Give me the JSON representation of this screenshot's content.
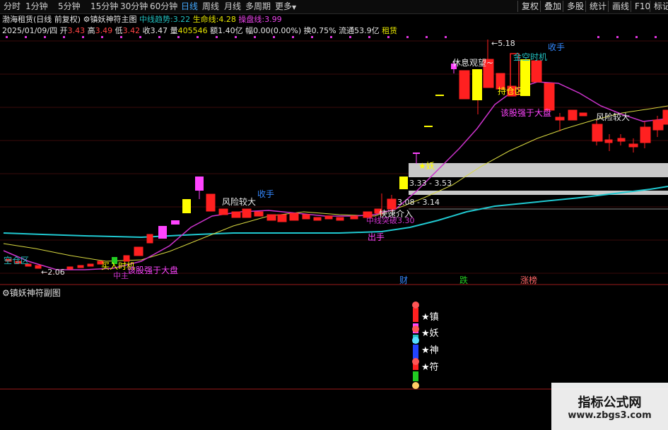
{
  "toolbar": {
    "timeframes": [
      "分时",
      "1分钟",
      "5分钟",
      "15分钟",
      "30分钟",
      "60分钟",
      "日线",
      "周线",
      "月线",
      "多周期",
      "更多"
    ],
    "active_timeframe": "日线",
    "more_arrow": "▼",
    "right_buttons": [
      "复权",
      "叠加",
      "多股",
      "统计",
      "画线",
      "F10",
      "标记"
    ]
  },
  "header": {
    "stock_name": "渤海租赁",
    "adjust_mode": "(日线 前复权)",
    "indicator_name": "镇妖神符主图",
    "mid_trend_label": "中线趋势:",
    "mid_trend_value": "3.22",
    "life_line_label": "生命线:",
    "life_line_value": "4.28",
    "operate_line_label": "操盘线:",
    "operate_line_value": "3.99"
  },
  "quote": {
    "date": "2025/01/09/四",
    "open_label": "开",
    "open": "3.43",
    "high_label": "高",
    "high": "3.49",
    "low_label": "低",
    "low": "3.42",
    "close_label": "收",
    "close": "3.47",
    "volume_label": "量",
    "volume": "405546",
    "amount_label": "额",
    "amount": "1.40亿",
    "change_label": "幅",
    "change": "0.00(0.00%)",
    "turnover_label": "换",
    "turnover": "0.75%",
    "float_label": "流通",
    "float": "53.9亿",
    "concept": "租赁"
  },
  "annotations": {
    "empty_zone": "空仓区",
    "low_price": "←2.06",
    "buy_time": "买入时机",
    "mid_label": "中主",
    "stronger_than_market_1": "该股强于大盘",
    "risk_high_1": "风险较大",
    "take_profit_1": "收手",
    "speed_enter": "快速介入",
    "break_trend": "中线突破3.30",
    "exit": "出手",
    "price_range_1": "3.08 - 3.14",
    "price_range_2": "3.33 - 3.53",
    "yao_star": "★妖",
    "rest_watch": "休息观望~",
    "high_price": "←5.18",
    "golden_chance": "金空时机",
    "take_profit_2": "收手",
    "hold_zone": "持仓区",
    "stronger_than_market_2": "该股强于大盘",
    "risk_high_2": "风险较大",
    "marker_cai": "财",
    "marker_die": "跌",
    "marker_zhangbang": "涨榜"
  },
  "sub_chart": {
    "title": "镇妖神符副图",
    "labels": [
      "★镇",
      "★妖",
      "★神",
      "★符"
    ]
  },
  "watermark": {
    "title": "指标公式网",
    "url": "www.zbgs3.com"
  },
  "colors": {
    "up": "#ff2020",
    "yellow_candle": "#ffff00",
    "magenta_candle": "#ff44ff",
    "ma_cyan": "#20c8d0",
    "ma_yellow": "#d8d840",
    "ma_magenta": "#cc33cc",
    "grey_band": "#c8c8c8"
  }
}
